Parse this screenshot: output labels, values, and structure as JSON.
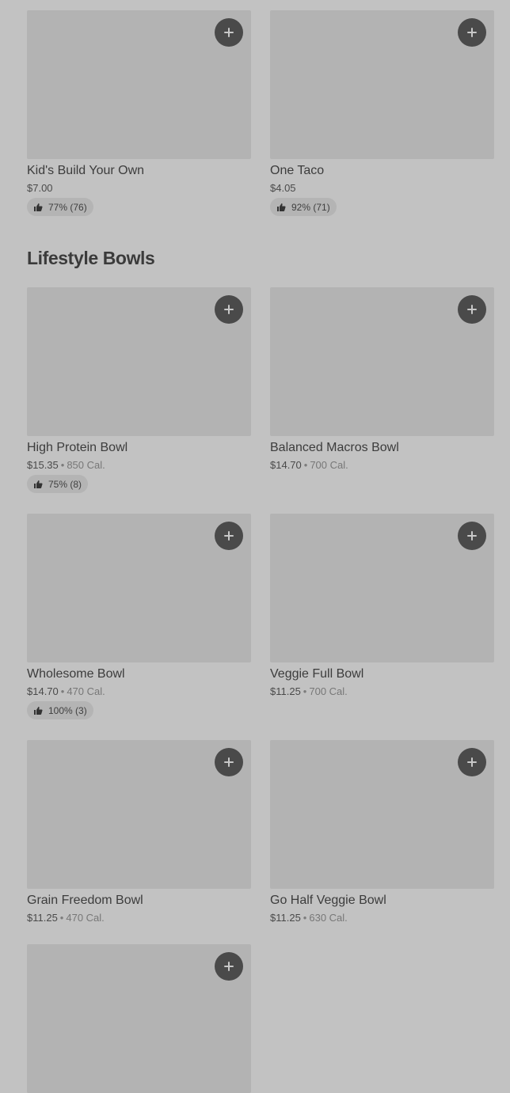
{
  "items_top": [
    {
      "name": "Kid's Build Your Own",
      "price": "$7.00",
      "calories": "",
      "rating": "77% (76)"
    },
    {
      "name": "One Taco",
      "price": "$4.05",
      "calories": "",
      "rating": "92% (71)"
    }
  ],
  "section": {
    "title": "Lifestyle Bowls"
  },
  "bowls": [
    {
      "name": "High Protein Bowl",
      "price": "$15.35",
      "calories": "850 Cal.",
      "rating": "75% (8)"
    },
    {
      "name": "Balanced Macros Bowl",
      "price": "$14.70",
      "calories": "700 Cal.",
      "rating": ""
    },
    {
      "name": "Wholesome Bowl",
      "price": "$14.70",
      "calories": "470 Cal.",
      "rating": "100% (3)"
    },
    {
      "name": "Veggie Full Bowl",
      "price": "$11.25",
      "calories": "700 Cal.",
      "rating": ""
    },
    {
      "name": "Grain Freedom Bowl",
      "price": "$11.25",
      "calories": "470 Cal.",
      "rating": ""
    },
    {
      "name": "Go Half Veggie Bowl",
      "price": "$11.25",
      "calories": "630 Cal.",
      "rating": ""
    }
  ],
  "icons": {
    "add": "plus-icon",
    "rating": "thumbs-up-icon"
  },
  "colors": {
    "background": "#c2c2c2",
    "image_placeholder": "#b3b3b3",
    "add_button": "#4a4a4a"
  }
}
